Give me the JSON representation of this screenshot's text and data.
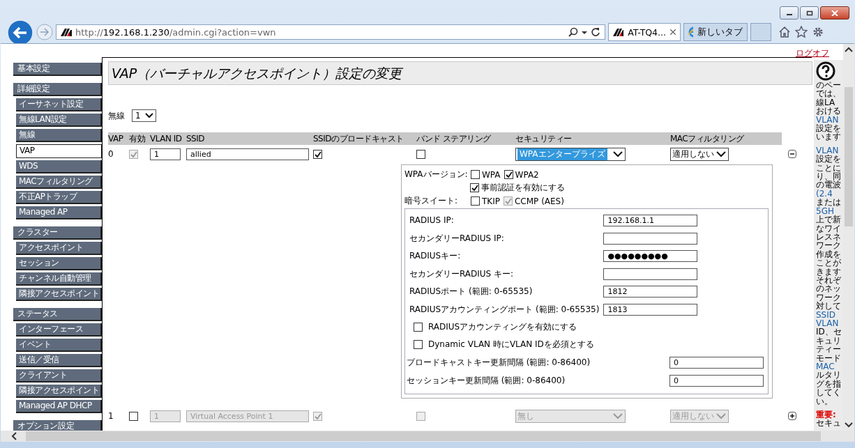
{
  "browser": {
    "url": {
      "scheme": "http://",
      "host": "192.168.1.230",
      "path": "/admin.cgi?action=vwn"
    },
    "tabs": [
      {
        "label": "AT-TQ4...",
        "selected": true,
        "closable": true,
        "kind": "site"
      },
      {
        "label": "新しいタブ",
        "selected": false,
        "closable": false,
        "kind": "new"
      }
    ]
  },
  "logoff": "ログオフ",
  "sidebar": {
    "groups": [
      {
        "label": "基本設定"
      },
      {
        "label": "詳細設定",
        "items": [
          {
            "label": "イーサネット設定",
            "selected": false
          },
          {
            "label": "無線LAN設定",
            "selected": false
          },
          {
            "label": "無線",
            "selected": false
          },
          {
            "label": "VAP",
            "selected": true
          },
          {
            "label": "WDS",
            "selected": false
          },
          {
            "label": "MACフィルタリング",
            "selected": false
          },
          {
            "label": "不正APトラップ",
            "selected": false
          },
          {
            "label": "Managed AP",
            "selected": false
          }
        ]
      },
      {
        "label": "クラスター",
        "items": [
          {
            "label": "アクセスポイント",
            "selected": false
          },
          {
            "label": "セッション",
            "selected": false
          },
          {
            "label": "チャンネル自動管理",
            "selected": false
          },
          {
            "label": "隣接アクセスポイント",
            "selected": false
          }
        ]
      },
      {
        "label": "ステータス",
        "items": [
          {
            "label": "インターフェース",
            "selected": false
          },
          {
            "label": "イベント",
            "selected": false
          },
          {
            "label": "送信／受信",
            "selected": false
          },
          {
            "label": "クライアント",
            "selected": false
          },
          {
            "label": "隣接アクセスポイント",
            "selected": false
          },
          {
            "label": "Managed AP DHCP",
            "selected": false
          }
        ]
      },
      {
        "label": "オプション設定"
      }
    ]
  },
  "page_title": "VAP（バーチャルアクセスポイント）設定の変更",
  "radio": {
    "label": "無線",
    "value": "1"
  },
  "table": {
    "columns": [
      "VAP",
      "有効",
      "VLAN ID",
      "SSID",
      "SSIDのブロードキャスト",
      "バンド ステアリング",
      "セキュリティー",
      "MACフィルタリング"
    ],
    "rows": [
      {
        "vap": "0",
        "expanded": true,
        "enabled": {
          "checked": true,
          "disabled": true
        },
        "vlan_id": {
          "value": "1",
          "disabled": false
        },
        "ssid": {
          "value": "allied",
          "disabled": false
        },
        "broadcast": {
          "checked": true,
          "disabled": false
        },
        "band_steering": {
          "checked": false,
          "disabled": false
        },
        "security": {
          "value": "WPAエンタープライズ",
          "disabled": false,
          "highlighted": true
        },
        "mac_filter": {
          "value": "適用しない",
          "disabled": false
        },
        "security_panel": {
          "wpa_version_label": "WPAバージョン:",
          "versions": [
            {
              "label": "WPA",
              "checked": false,
              "disabled": false
            },
            {
              "label": "WPA2",
              "checked": true,
              "disabled": false
            }
          ],
          "preauth": {
            "label": "事前認証を有効にする",
            "checked": true
          },
          "cipher_label": "暗号スイート:",
          "ciphers": [
            {
              "label": "TKIP",
              "checked": false,
              "disabled": false
            },
            {
              "label": "CCMP (AES)",
              "checked": true,
              "disabled": true
            }
          ],
          "radius_fields": [
            {
              "label": "RADIUS IP:",
              "value": "192.168.1.1"
            },
            {
              "label": "セカンダリーRADIUS IP:"
            },
            {
              "label": "RADIUSキー:",
              "value": "●●●●●●●●●"
            },
            {
              "label": "セカンダリーRADIUS キー:"
            },
            {
              "label": "RADIUSポート (範囲: 0-65535)",
              "value": "1812"
            },
            {
              "label": "RADIUSアカウンティングポート (範囲: 0-65535)",
              "value": "1813"
            }
          ],
          "radius_options": [
            {
              "label": "RADIUSアカウンティングを有効にする",
              "checked": false
            },
            {
              "label": "Dynamic VLAN 時にVLAN IDを必須とする",
              "checked": false
            }
          ],
          "interval_fields": [
            {
              "label": "ブロードキャストキー更新間隔 (範囲: 0-86400)",
              "value": "0"
            },
            {
              "label": "セッションキー更新間隔 (範囲: 0-86400)",
              "value": "0"
            }
          ]
        }
      },
      {
        "vap": "1",
        "expanded": false,
        "enabled": {
          "checked": false,
          "disabled": false
        },
        "vlan_id": {
          "value": "1",
          "disabled": true
        },
        "ssid": {
          "value": "Virtual Access Point 1",
          "disabled": true
        },
        "broadcast": {
          "checked": true,
          "disabled": true
        },
        "band_steering": {
          "checked": false,
          "disabled": true
        },
        "security": {
          "value": "無し",
          "disabled": true,
          "highlighted": false
        },
        "mac_filter": {
          "value": "適用しない",
          "disabled": true
        }
      }
    ]
  },
  "help": {
    "paragraphs": [
      {
        "lines": [
          {
            "text": "のペー",
            "kind": "plain"
          },
          {
            "text": "では、",
            "kind": "plain"
          },
          {
            "text": "線LA",
            "kind": "plain"
          },
          {
            "text": "おける",
            "kind": "plain"
          },
          {
            "text": "VLAN",
            "kind": "link"
          },
          {
            "text": "設定を",
            "kind": "plain"
          },
          {
            "text": "います",
            "kind": "plain"
          }
        ]
      },
      {
        "lines": [
          {
            "text": "VLAN",
            "kind": "link"
          },
          {
            "text": "設定を",
            "kind": "plain"
          },
          {
            "text": "ことに",
            "kind": "plain"
          },
          {
            "text": "り、同",
            "kind": "plain"
          },
          {
            "text": "の電波",
            "kind": "plain"
          },
          {
            "text": "(2.4",
            "kind": "link"
          },
          {
            "text": "または",
            "kind": "plain"
          },
          {
            "text": "5GH",
            "kind": "link"
          },
          {
            "text": "上で新",
            "kind": "plain"
          },
          {
            "text": "なワイ",
            "kind": "plain"
          },
          {
            "text": "レスネ",
            "kind": "plain"
          },
          {
            "text": "ワーク",
            "kind": "plain"
          },
          {
            "text": "作成を",
            "kind": "plain"
          },
          {
            "text": "ことが",
            "kind": "plain"
          },
          {
            "text": "きます",
            "kind": "plain"
          },
          {
            "text": "それぞ",
            "kind": "plain"
          },
          {
            "text": "のネッ",
            "kind": "plain"
          },
          {
            "text": "ワーク",
            "kind": "plain"
          },
          {
            "text": "対して",
            "kind": "plain"
          },
          {
            "text": "SSID",
            "kind": "link"
          },
          {
            "text": "VLAN",
            "kind": "link"
          },
          {
            "text": "ID、セ",
            "kind": "plain"
          },
          {
            "text": "キュリ",
            "kind": "plain"
          },
          {
            "text": "ティー",
            "kind": "plain"
          },
          {
            "text": "モード",
            "kind": "plain"
          },
          {
            "text": "MAC",
            "kind": "link"
          },
          {
            "text": "ルタリ",
            "kind": "plain"
          },
          {
            "text": "グを指",
            "kind": "plain"
          },
          {
            "text": "してく",
            "kind": "plain"
          },
          {
            "text": "い。",
            "kind": "plain"
          }
        ]
      },
      {
        "lines": [
          {
            "text": "重要:",
            "kind": "warning"
          },
          {
            "text": "セキュ",
            "kind": "plain"
          }
        ]
      }
    ]
  }
}
